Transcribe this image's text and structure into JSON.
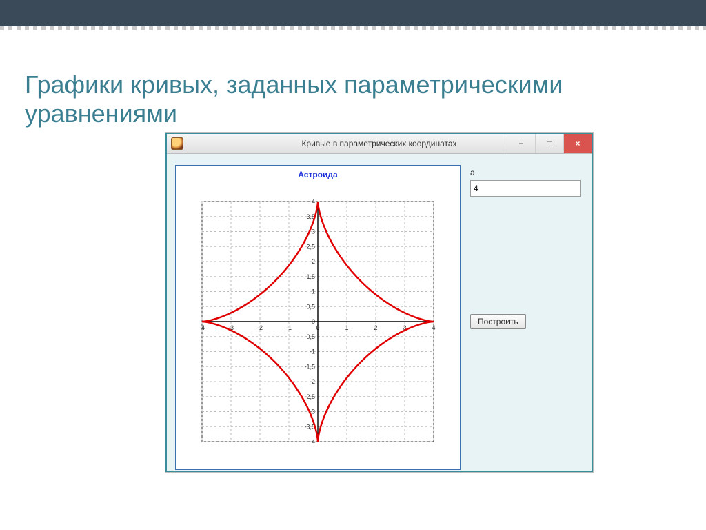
{
  "slide": {
    "title": "Графики кривых, заданных параметрическими уравнениями"
  },
  "window": {
    "title": "Кривые в параметрических координатах",
    "min_symbol": "−",
    "max_symbol": "□",
    "close_symbol": "×"
  },
  "controls": {
    "a_label": "a",
    "a_value": "4",
    "build_button": "Построить"
  },
  "chart_data": {
    "type": "line",
    "title": "Астроида",
    "xlabel": "",
    "ylabel": "",
    "xlim": [
      -4,
      4
    ],
    "ylim": [
      -4,
      4
    ],
    "x_ticks": [
      -4,
      -3,
      -2,
      -1,
      0,
      1,
      2,
      3,
      4
    ],
    "y_ticks": [
      -4,
      -3.5,
      -3,
      -2.5,
      -2,
      -1.5,
      -1,
      -0.5,
      0,
      0.5,
      1,
      1.5,
      2,
      2.5,
      3,
      3.5,
      4
    ],
    "parametric": {
      "x_of_t": "4*cos(t)^3",
      "y_of_t": "4*sin(t)^3",
      "t_range": [
        0,
        6.283185307
      ]
    },
    "series": [
      {
        "name": "Астроида",
        "cusp_points": [
          {
            "x": 4,
            "y": 0
          },
          {
            "x": 0,
            "y": 4
          },
          {
            "x": -4,
            "y": 0
          },
          {
            "x": 0,
            "y": -4
          }
        ]
      }
    ]
  }
}
